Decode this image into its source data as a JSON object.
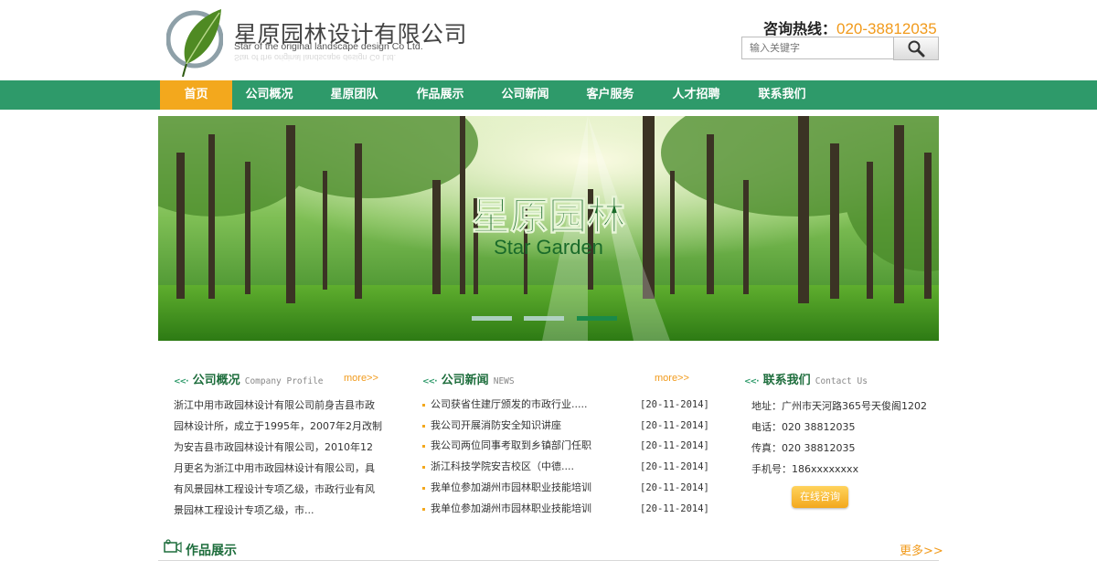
{
  "header": {
    "company_name": "星原园林设计有限公司",
    "company_name_en": "Star of the original landscape design Co Ltd.",
    "hotline_label": "咨询热线：",
    "hotline_number": "020-38812035",
    "search_placeholder": "输入关键字"
  },
  "nav": {
    "items": [
      {
        "label": "首页",
        "active": true
      },
      {
        "label": "公司概况"
      },
      {
        "label": "星原团队"
      },
      {
        "label": "作品展示"
      },
      {
        "label": "公司新闻"
      },
      {
        "label": "客户服务"
      },
      {
        "label": "人才招聘"
      },
      {
        "label": "联系我们"
      }
    ]
  },
  "banner": {
    "title_cn": "星原园林",
    "title_en": "Star Garden",
    "slides": 3,
    "active_slide": 3
  },
  "profile": {
    "title": "公司概况",
    "subtitle": "Company Profile",
    "more": "more>>",
    "text": "浙江中用市政园林设计有限公司前身吉县市政园林设计所，成立于1995年，2007年2月改制为安吉县市政园林设计有限公司，2010年12月更名为浙江中用市政园林设计有限公司，具有风景园林工程设计专项乙级，市政行业有风景园林工程设计专项乙级，市..."
  },
  "news": {
    "title": "公司新闻",
    "subtitle": "NEWS",
    "more": "more>>",
    "items": [
      {
        "title": "公司获省住建厅颁发的市政行业.....",
        "date": "[20-11-2014]"
      },
      {
        "title": "我公司开展消防安全知识讲座",
        "date": "[20-11-2014]"
      },
      {
        "title": "我公司两位同事考取到乡镇部门任职",
        "date": "[20-11-2014]"
      },
      {
        "title": "浙江科技学院安吉校区（中德....",
        "date": "[20-11-2014]"
      },
      {
        "title": "我单位参加湖州市园林职业技能培训",
        "date": "[20-11-2014]"
      },
      {
        "title": "我单位参加湖州市园林职业技能培训",
        "date": "[20-11-2014]"
      }
    ]
  },
  "contact": {
    "title": "联系我们",
    "subtitle": "Contact Us",
    "address": "地址：广州市天河路365号天俊阁1202",
    "phone": "电话：020 38812035",
    "fax": "传真：020 38812035",
    "mobile": "手机号：186xxxxxxxx",
    "consult_button": "在线咨询"
  },
  "works": {
    "title": "作品展示",
    "more": "更多>>"
  },
  "colors": {
    "nav_green": "#2e9a6a",
    "accent_orange": "#f3a81d",
    "title_green": "#1d6d3c"
  }
}
